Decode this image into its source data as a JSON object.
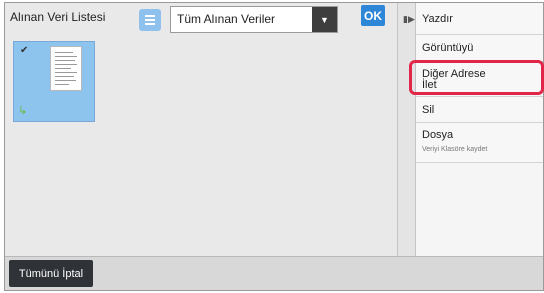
{
  "header": {
    "title": "Alınan Veri Listesi",
    "filter_selected": "Tüm Alınan Veriler",
    "ok_label": "OK"
  },
  "menu": {
    "items": [
      {
        "label": "Yazdır"
      },
      {
        "label": "Görüntüyü"
      },
      {
        "label": "Diğer Adrese\nİlet"
      },
      {
        "label": "Sil"
      },
      {
        "label": "Dosya",
        "sublabel": "Veriyi Klasöre kaydet"
      }
    ]
  },
  "footer": {
    "cancel_all_label": "Tümünü İptal"
  },
  "colors": {
    "accent_blue": "#2d86d6",
    "thumbnail_bg": "#8cc4ee",
    "highlight_red": "#e2264a",
    "dark_button": "#2f3237"
  },
  "icons": {
    "list_view": "list-icon",
    "dropdown": "chevron-down-icon",
    "selected": "checkmark-icon",
    "forward": "forward-icon",
    "panel_toggle": "collapse-panel-icon"
  }
}
